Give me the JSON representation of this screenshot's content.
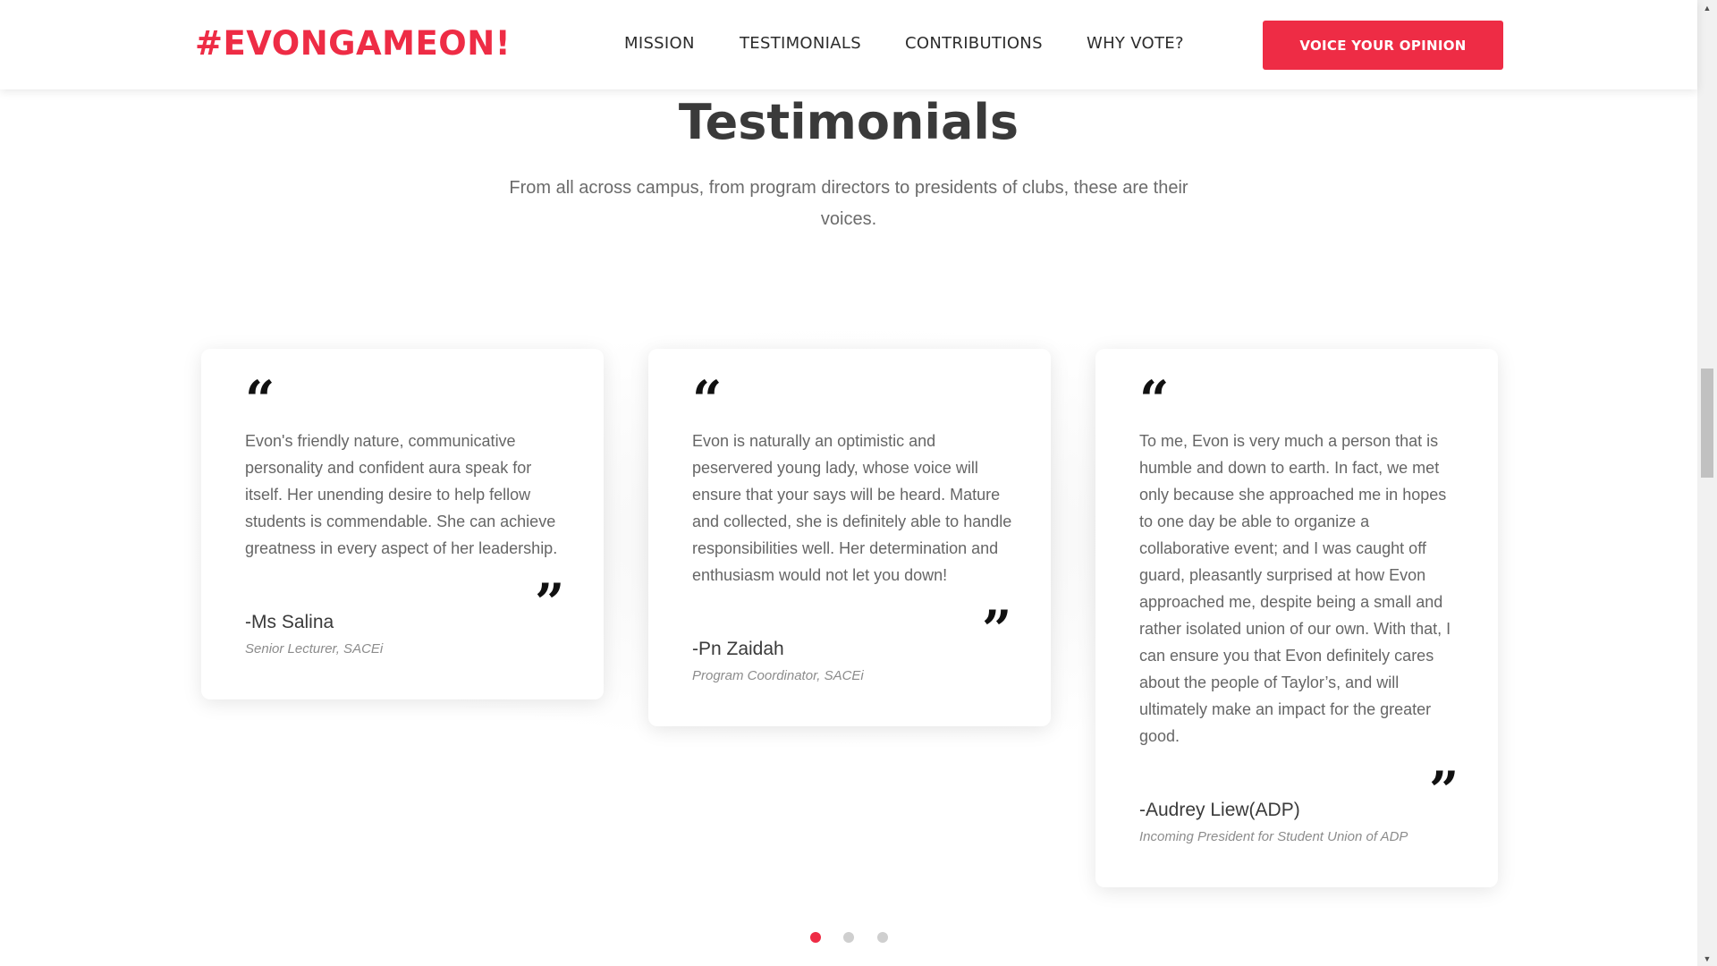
{
  "header": {
    "logo": "#EVONGAMEON!",
    "nav": [
      "MISSION",
      "TESTIMONIALS",
      "CONTRIBUTIONS",
      "WHY VOTE?"
    ],
    "cta": "VOICE YOUR OPINION"
  },
  "section": {
    "title": "Testimonials",
    "subtitle": "From all across campus, from program directors to presidents of clubs, these are their voices."
  },
  "testimonials": [
    {
      "quote": "Evon's friendly nature, communicative personality and confident aura speak for itself. Her unending desire to help fellow students is commendable. She can achieve greatness in every aspect of her leadership.",
      "name": "-Ms Salina",
      "role": "Senior Lecturer, SACEi"
    },
    {
      "quote": "Evon is naturally an optimistic and peservered young lady, whose voice will ensure that your says will be heard. Mature and collected, she is definitely able to handle responsibilities well. Her determination and enthusiasm would not let you down!",
      "name": "-Pn Zaidah",
      "role": "Program Coordinator, SACEi"
    },
    {
      "quote": "To me, Evon is very much a person that is  humble and down to earth. In fact, we met only because she approached me in hopes to one day be able to organize a collaborative event; and I was caught off guard, pleasantly surprised at how Evon approached me, despite being a small and rather isolated union of our own. With that, I can ensure you that Evon definitely cares about the people of Taylor’s, and will ultimately make an impact for the greater good.",
      "name": "-Audrey Liew(ADP)",
      "role": "Incoming President for Student Union of ADP"
    }
  ],
  "carousel": {
    "pages": 3,
    "active_page": 1
  },
  "icons": {
    "quote_open": "open-quote-icon",
    "quote_close": "close-quote-icon",
    "scroll_up": "scroll-up-arrow-icon",
    "scroll_down": "scroll-down-arrow-icon"
  },
  "colors": {
    "accent": "#ee2c45",
    "heading": "#3a3a3a",
    "body_text": "#666666",
    "dot_inactive": "#cfcfcf"
  }
}
